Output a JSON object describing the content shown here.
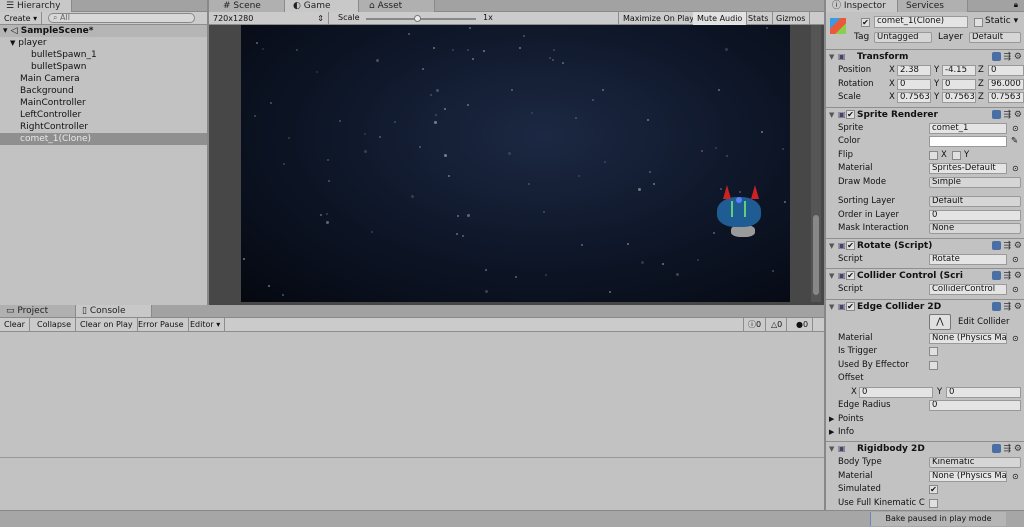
{
  "hierarchy": {
    "tab": "Hierarchy",
    "create": "Create",
    "search_placeholder": "All",
    "scene": "SampleScene*",
    "items": [
      {
        "label": "player",
        "indent": 1
      },
      {
        "label": "bulletSpawn_1",
        "indent": 2
      },
      {
        "label": "bulletSpawn",
        "indent": 2
      },
      {
        "label": "Main Camera",
        "indent": 1
      },
      {
        "label": "Background",
        "indent": 1
      },
      {
        "label": "MainController",
        "indent": 1
      },
      {
        "label": "LeftController",
        "indent": 1
      },
      {
        "label": "RightController",
        "indent": 1
      },
      {
        "label": "comet_1(Clone)",
        "indent": 1,
        "selected": true
      }
    ]
  },
  "center": {
    "tabs": [
      "Scene",
      "Game",
      "Asset Store"
    ],
    "resolution": "720x1280",
    "scale_label": "Scale",
    "scale_value": "1x",
    "buttons": [
      "Maximize On Play",
      "Mute Audio",
      "Stats",
      "Gizmos"
    ]
  },
  "bottom": {
    "tabs": [
      "Project",
      "Console"
    ],
    "buttons": [
      "Clear",
      "Collapse",
      "Clear on Play",
      "Error Pause",
      "Editor"
    ],
    "counts": {
      "info": "0",
      "warn": "0",
      "error": "0"
    },
    "status": "Bake paused in play mode"
  },
  "inspector": {
    "tabs": [
      "Inspector",
      "Services"
    ],
    "object_name": "comet_1(Clone)",
    "static": "Static",
    "tag_label": "Tag",
    "tag": "Untagged",
    "layer_label": "Layer",
    "layer": "Default",
    "transform": {
      "title": "Transform",
      "position": {
        "label": "Position",
        "x": "2.38",
        "y": "-4.15",
        "z": "0"
      },
      "rotation": {
        "label": "Rotation",
        "x": "0",
        "y": "0",
        "z": "96.000"
      },
      "scale": {
        "label": "Scale",
        "x": "0.7563",
        "y": "0.7563",
        "z": "0.7563"
      }
    },
    "sprite_renderer": {
      "title": "Sprite Renderer",
      "sprite_label": "Sprite",
      "sprite": "comet_1",
      "color_label": "Color",
      "flip_label": "Flip",
      "flip_x": "X",
      "flip_y": "Y",
      "material_label": "Material",
      "material": "Sprites-Default",
      "draw_mode_label": "Draw Mode",
      "draw_mode": "Simple",
      "sorting_layer_label": "Sorting Layer",
      "sorting_layer": "Default",
      "order_label": "Order in Layer",
      "order": "0",
      "mask_label": "Mask Interaction",
      "mask": "None"
    },
    "rotate": {
      "title": "Rotate (Script)",
      "script_label": "Script",
      "script": "Rotate"
    },
    "collider_control": {
      "title": "Collider Control (Scri",
      "script_label": "Script",
      "script": "ColliderControl"
    },
    "edge_collider": {
      "title": "Edge Collider 2D",
      "edit": "Edit Collider",
      "material_label": "Material",
      "material": "None (Physics Ma",
      "trigger_label": "Is Trigger",
      "effector_label": "Used By Effector",
      "offset_label": "Offset",
      "offset_x": "0",
      "offset_y": "0",
      "radius_label": "Edge Radius",
      "radius": "0",
      "points": "Points",
      "info": "Info"
    },
    "rigidbody": {
      "title": "Rigidbody 2D",
      "body_type_label": "Body Type",
      "body_type": "Kinematic",
      "material_label": "Material",
      "material": "None (Physics Ma",
      "simulated_label": "Simulated",
      "full_kinematic_label": "Use Full Kinematic C"
    }
  }
}
